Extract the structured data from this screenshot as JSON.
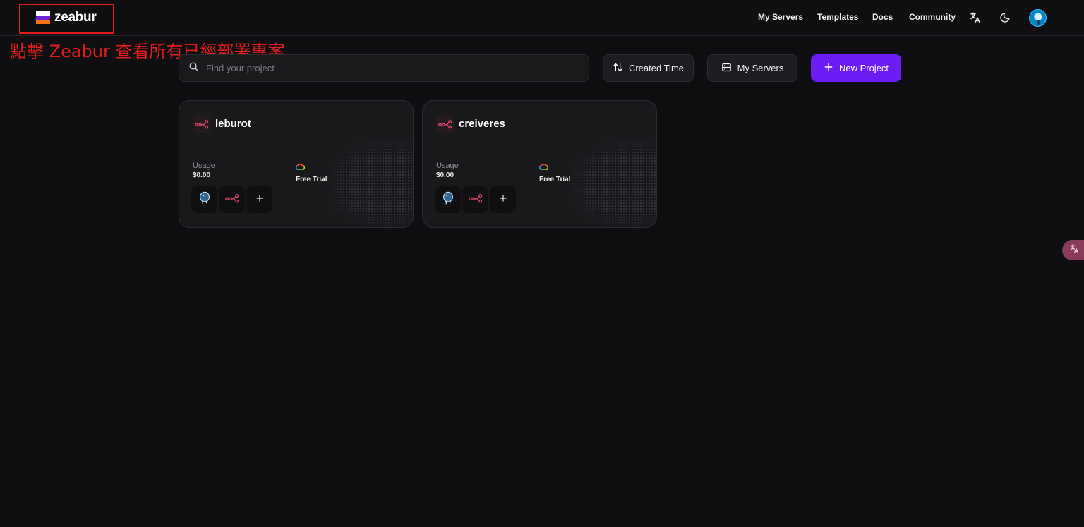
{
  "header": {
    "logo_text": "zeabur",
    "nav": [
      "My Servers",
      "Templates",
      "Docs",
      "Community"
    ],
    "icons": [
      "translate-icon",
      "moon-icon",
      "avatar"
    ]
  },
  "annotation": "點擊 Zeabur 查看所有已經部署專案",
  "toolbar": {
    "search_placeholder": "Find your project",
    "sort_label": "Created Time",
    "servers_label": "My Servers",
    "new_project_label": "New Project"
  },
  "projects": [
    {
      "name": "leburot",
      "usage_label": "Usage",
      "usage_value": "$0.00",
      "plan": "Free Trial"
    },
    {
      "name": "creiveres",
      "usage_label": "Usage",
      "usage_value": "$0.00",
      "plan": "Free Trial"
    }
  ],
  "colors": {
    "background": "#0f0f11",
    "accent": "#6c1cf5",
    "annotation": "#e11d1d",
    "service_icon": "#e0466a"
  }
}
